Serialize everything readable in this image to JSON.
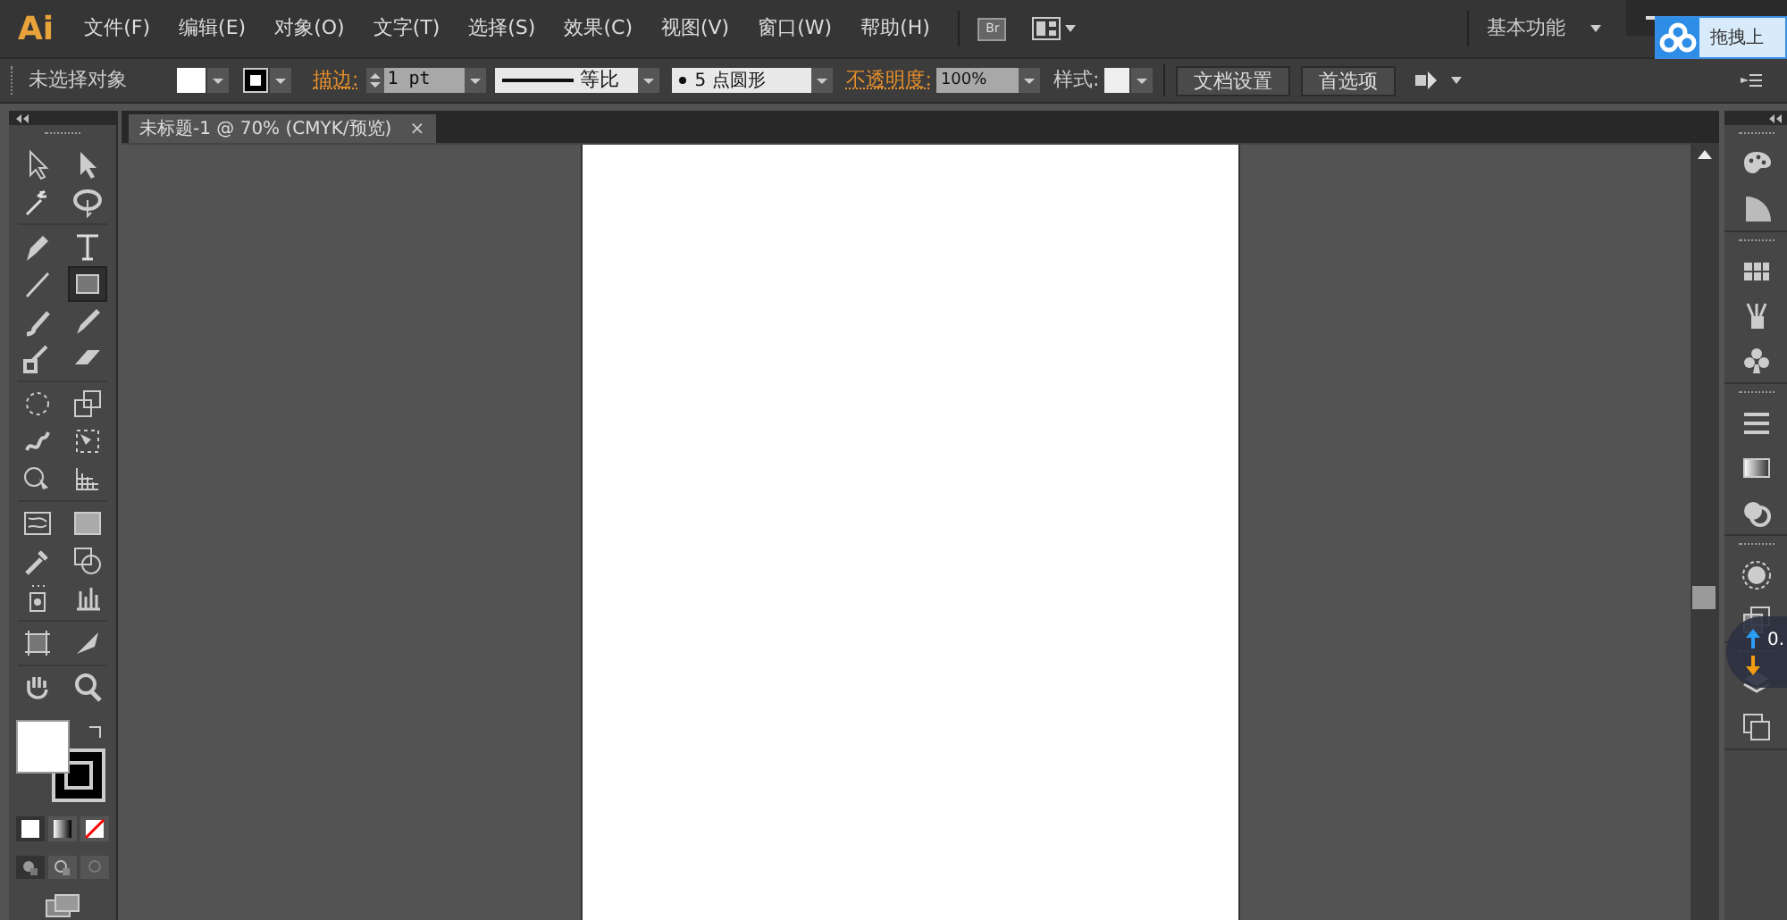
{
  "app": {
    "logo": "Ai"
  },
  "menu": [
    "文件(F)",
    "编辑(E)",
    "对象(O)",
    "文字(T)",
    "选择(S)",
    "效果(C)",
    "视图(V)",
    "窗口(W)",
    "帮助(H)"
  ],
  "app_bar": {
    "bridge": "Br",
    "workspace": "基本功能"
  },
  "control_bar": {
    "selection": "未选择对象",
    "stroke_label": "描边:",
    "stroke_weight": "1 pt",
    "profile": "等比",
    "brush": "5 点圆形",
    "opacity_label": "不透明度:",
    "opacity": "100%",
    "style_label": "样式:",
    "buttons": [
      "文档设置",
      "首选项"
    ]
  },
  "document_tab": {
    "title": "未标题-1 @ 70% (CMYK/预览)",
    "close": "×"
  },
  "tools": [
    {
      "selected": false
    },
    {
      "selected": false
    },
    {
      "selected": false
    },
    {
      "selected": false
    },
    {
      "selected": false
    },
    {
      "selected": false
    },
    {
      "selected": false
    },
    {
      "selected": true
    },
    {
      "selected": false
    },
    {
      "selected": false
    },
    {
      "selected": false
    },
    {
      "selected": false
    },
    {
      "selected": false
    },
    {
      "selected": false
    },
    {
      "selected": false
    },
    {
      "selected": false
    },
    {
      "selected": false
    },
    {
      "selected": false
    },
    {
      "selected": false
    },
    {
      "selected": false
    },
    {
      "selected": false
    },
    {
      "selected": false
    },
    {
      "selected": false
    },
    {
      "selected": false
    },
    {
      "selected": false
    },
    {
      "selected": false
    },
    {
      "selected": false
    },
    {
      "selected": false
    }
  ],
  "upload_tip": {
    "text": "拖拽上"
  },
  "speed_bubble": {
    "text": "0."
  }
}
